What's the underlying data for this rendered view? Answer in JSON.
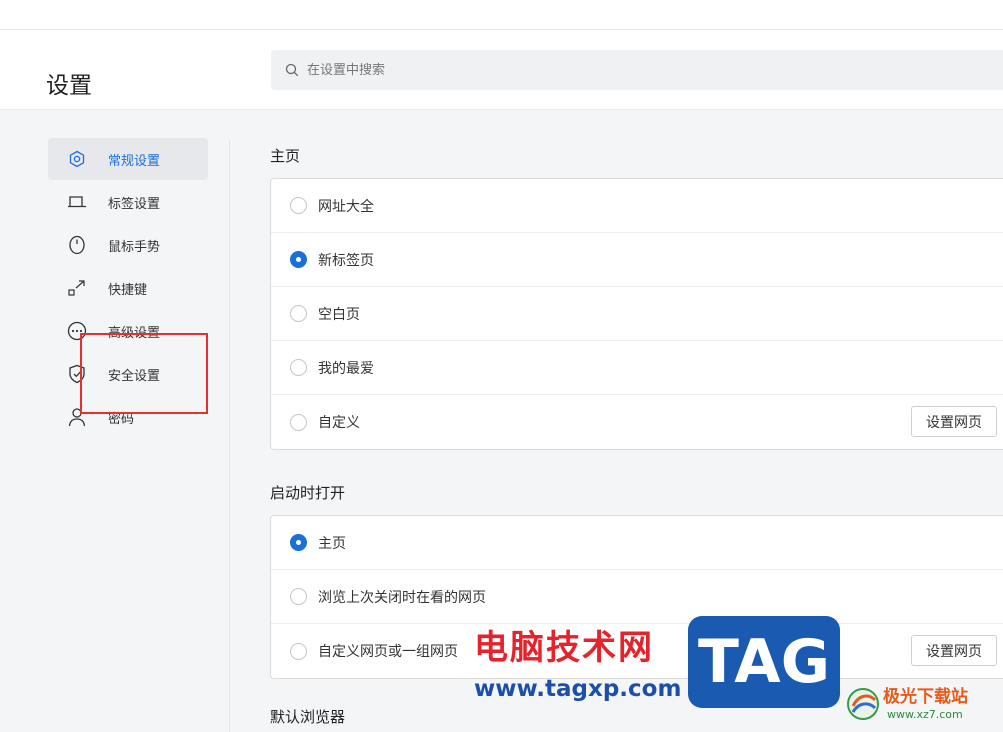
{
  "header": {
    "title": "设置",
    "search_placeholder": "在设置中搜索"
  },
  "sidebar": {
    "items": [
      {
        "label": "常规设置",
        "icon": "gear-hexagon-icon",
        "active": true
      },
      {
        "label": "标签设置",
        "icon": "tab-icon",
        "active": false
      },
      {
        "label": "鼠标手势",
        "icon": "mouse-icon",
        "active": false
      },
      {
        "label": "快捷键",
        "icon": "shortcut-arrow-icon",
        "active": false
      },
      {
        "label": "高级设置",
        "icon": "more-dots-icon",
        "active": false
      },
      {
        "label": "安全设置",
        "icon": "shield-icon",
        "active": false
      },
      {
        "label": "密码",
        "icon": "user-icon",
        "active": false
      }
    ]
  },
  "homepage": {
    "title": "主页",
    "options": [
      "网址大全",
      "新标签页",
      "空白页",
      "我的最爱",
      "自定义"
    ],
    "selected": "新标签页",
    "button": "设置网页"
  },
  "startup": {
    "title": "启动时打开",
    "options": [
      "主页",
      "浏览上次关闭时在看的网页",
      "自定义网页或一组网页"
    ],
    "selected": "主页",
    "button": "设置网页"
  },
  "default_browser": {
    "title": "默认浏览器"
  },
  "watermark": {
    "site_name": "电脑技术网",
    "site_url": "www.tagxp.com",
    "tag_logo": "TAG",
    "brand2": "极光下载站",
    "brand2_url": "www.xz7.com"
  },
  "colors": {
    "accent": "#1b6fd8",
    "highlight_box": "#e0322f"
  }
}
